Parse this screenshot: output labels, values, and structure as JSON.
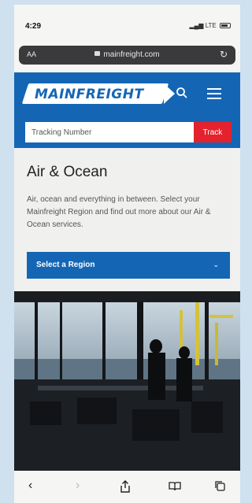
{
  "status": {
    "time": "4:29",
    "network": "LTE"
  },
  "browser": {
    "text_size": "AA",
    "url": "mainfreight.com"
  },
  "header": {
    "logo": "MAINFREIGHT"
  },
  "tracking": {
    "placeholder": "Tracking Number",
    "button": "Track"
  },
  "page": {
    "title": "Air & Ocean",
    "description": "Air, ocean and everything in between. Select your Mainfreight Region and find out more about our Air & Ocean services."
  },
  "region": {
    "label": "Select a Region"
  },
  "colors": {
    "brand_blue": "#1466b5",
    "track_red": "#e3222e"
  },
  "toolbar": {
    "icons": [
      "back-icon",
      "forward-icon",
      "share-icon",
      "bookmarks-icon",
      "tabs-icon"
    ]
  }
}
